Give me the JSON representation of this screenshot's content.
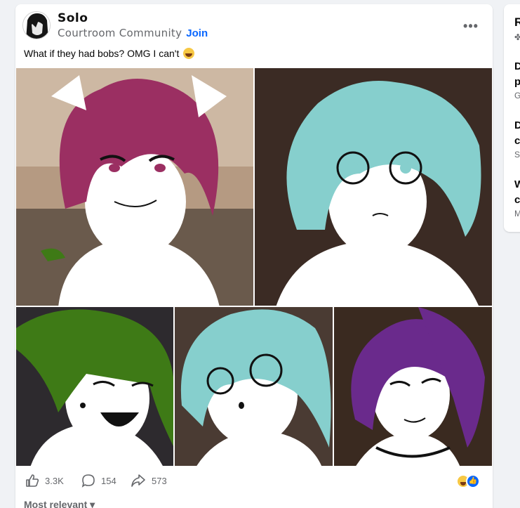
{
  "post": {
    "author": "Solo",
    "group": "Courtroom Community",
    "join_label": "Join",
    "more_label": "•••",
    "caption": "What if they had bobs? OMG I can't"
  },
  "images": [
    {
      "hair_color": "#9b2f62"
    },
    {
      "hair_color": "#86cfcd"
    },
    {
      "hair_color": "#3e7a16"
    },
    {
      "hair_color": "#86cfcd"
    },
    {
      "hair_color": "#6a2a8c"
    }
  ],
  "actions": {
    "likes": "3.3K",
    "comments": "154",
    "shares": "573"
  },
  "sort_label": "Most relevant",
  "sidebar": {
    "title": "R",
    "subtitle": "✤",
    "items": [
      {
        "line1": "D",
        "line2": "p",
        "line3": "G"
      },
      {
        "line1": "D",
        "line2": "c",
        "line3": "S"
      },
      {
        "line1": "W",
        "line2": "c",
        "line3": "M"
      }
    ]
  },
  "colors": {
    "accent": "#0866ff",
    "secondary_text": "#65676b",
    "background": "#f0f2f5"
  }
}
